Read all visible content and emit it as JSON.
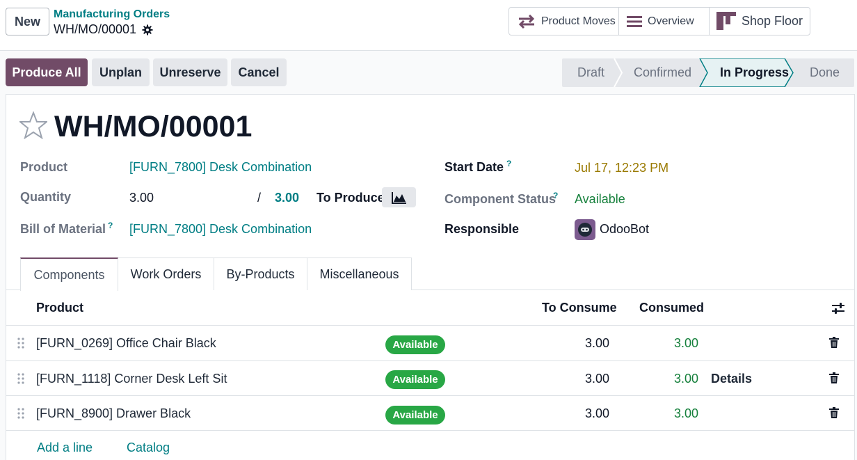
{
  "control_panel": {
    "new_label": "New",
    "breadcrumb_parent": "Manufacturing Orders",
    "breadcrumb_current": "WH/MO/00001",
    "smart_buttons": [
      {
        "label": "Product Moves",
        "icon": "arrows-exchange-icon"
      },
      {
        "label": "Overview",
        "icon": "list-icon"
      },
      {
        "label": "Shop Floor",
        "icon": "kanban-icon"
      }
    ]
  },
  "actions": {
    "produce_all": "Produce All",
    "unplan": "Unplan",
    "unreserve": "Unreserve",
    "cancel": "Cancel"
  },
  "status": {
    "stages": [
      "Draft",
      "Confirmed",
      "In Progress",
      "Done"
    ],
    "current": "In Progress"
  },
  "form": {
    "title": "WH/MO/00001",
    "product_label": "Product",
    "product_value": "[FURN_7800] Desk Combination",
    "quantity_label": "Quantity",
    "quantity_value": "3.00",
    "quantity_sep": "/",
    "quantity_target": "3.00",
    "to_produce_label": "To Produce",
    "bom_label": "Bill of Material",
    "bom_help": "?",
    "bom_value": "[FURN_7800] Desk Combination",
    "start_date_label": "Start Date",
    "start_date_help": "?",
    "start_date_value": "Jul 17, 12:23 PM",
    "component_status_label": "Component Status",
    "component_status_help": "?",
    "component_status_value": "Available",
    "responsible_label": "Responsible",
    "responsible_value": "OdooBot"
  },
  "tabs": [
    "Components",
    "Work Orders",
    "By-Products",
    "Miscellaneous"
  ],
  "table": {
    "headers": {
      "product": "Product",
      "to_consume": "To Consume",
      "consumed": "Consumed"
    },
    "rows": [
      {
        "product": "[FURN_0269] Office Chair Black",
        "status": "Available",
        "to_consume": "3.00",
        "consumed": "3.00",
        "details": ""
      },
      {
        "product": "[FURN_1118] Corner Desk Left Sit",
        "status": "Available",
        "to_consume": "3.00",
        "consumed": "3.00",
        "details": "Details"
      },
      {
        "product": "[FURN_8900] Drawer Black",
        "status": "Available",
        "to_consume": "3.00",
        "consumed": "3.00",
        "details": ""
      }
    ],
    "add_line": "Add a line",
    "catalog": "Catalog"
  },
  "colors": {
    "brand": "#714b67",
    "link": "#017e84",
    "success": "#28a745"
  }
}
